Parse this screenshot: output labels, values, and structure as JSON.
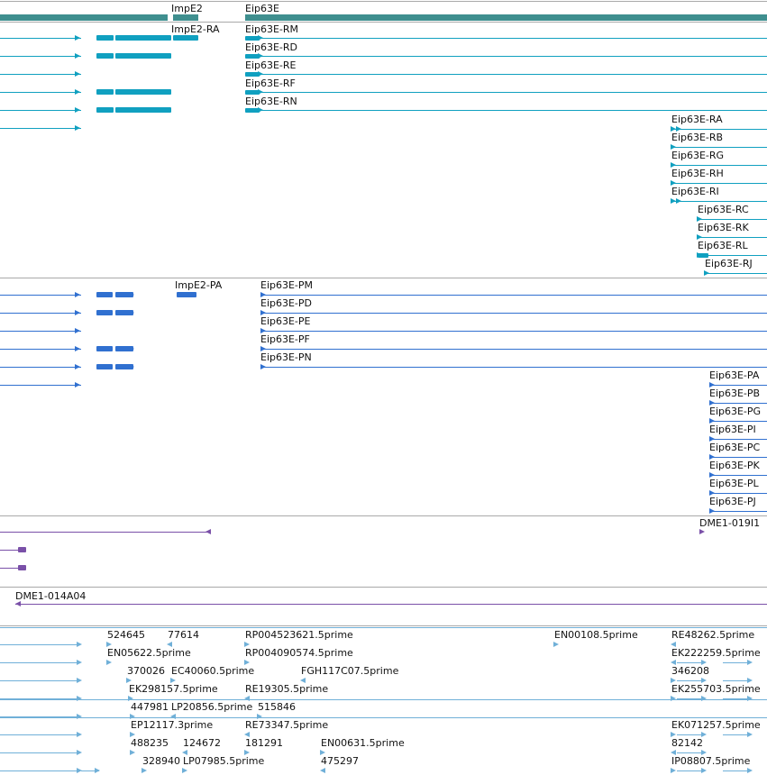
{
  "colors": {
    "gene": "#3f8f8f",
    "transcript": "#10a0c0",
    "protein": "#3070d0",
    "clone": "#7a50a8",
    "est": "#70b0d8",
    "separator": "#a9a9a9"
  },
  "genes": {
    "impe2": "ImpE2",
    "eip63e": "Eip63E"
  },
  "transcripts": [
    "ImpE2-RA",
    "Eip63E-RM",
    "Eip63E-RD",
    "Eip63E-RE",
    "Eip63E-RF",
    "Eip63E-RN",
    "Eip63E-RA",
    "Eip63E-RB",
    "Eip63E-RG",
    "Eip63E-RH",
    "Eip63E-RI",
    "Eip63E-RC",
    "Eip63E-RK",
    "Eip63E-RL",
    "Eip63E-RJ"
  ],
  "proteins": [
    "ImpE2-PA",
    "Eip63E-PM",
    "Eip63E-PD",
    "Eip63E-PE",
    "Eip63E-PF",
    "Eip63E-PN",
    "Eip63E-PA",
    "Eip63E-PB",
    "Eip63E-PG",
    "Eip63E-PI",
    "Eip63E-PC",
    "Eip63E-PK",
    "Eip63E-PL",
    "Eip63E-PJ"
  ],
  "clones": [
    "DME1-019I1",
    "DME1-014A04"
  ],
  "ests": [
    "524645",
    "77614",
    "RP004523621.5prime",
    "EN00108.5prime",
    "RE48262.5prime",
    "EN05622.5prime",
    "RP004090574.5prime",
    "EK222259.5prime",
    "370026",
    "EC40060.5prime",
    "FGH117C07.5prime",
    "346208",
    "EK298157.5prime",
    "RE19305.5prime",
    "EK255703.5prime",
    "447981",
    "LP20856.5prime",
    "515846",
    "EP12117.3prime",
    "RE73347.5prime",
    "EK071257.5prime",
    "488235",
    "124672",
    "181291",
    "EN00631.5prime",
    "82142",
    "328940",
    "LP07985.5prime",
    "475297",
    "IP08807.5prime"
  ]
}
